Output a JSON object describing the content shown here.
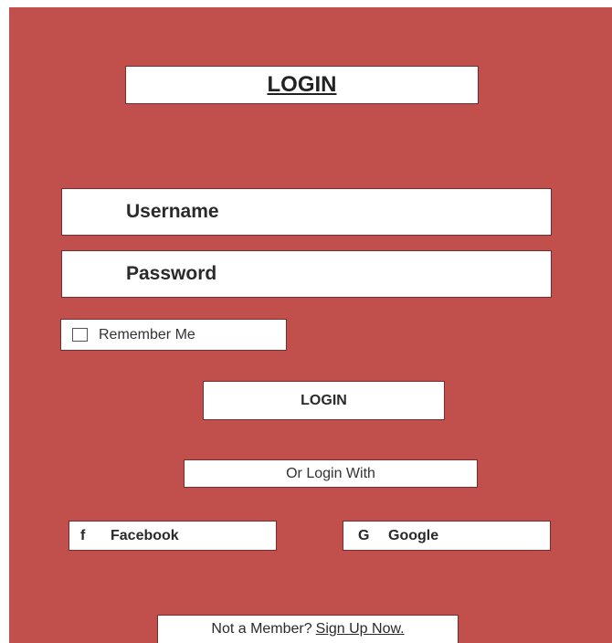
{
  "header": {
    "title": "LOGIN"
  },
  "form": {
    "username_placeholder": "Username",
    "password_placeholder": "Password",
    "remember_label": "Remember Me",
    "login_button": "LOGIN"
  },
  "social": {
    "divider_label": "Or Login With",
    "facebook": {
      "icon_label": "f",
      "label": "Facebook"
    },
    "google": {
      "icon_label": "G",
      "label": "Google"
    }
  },
  "footer": {
    "prompt": "Not a Member?",
    "signup_link": "Sign Up Now."
  },
  "colors": {
    "background": "#c14f4b",
    "box": "#ffffff"
  }
}
